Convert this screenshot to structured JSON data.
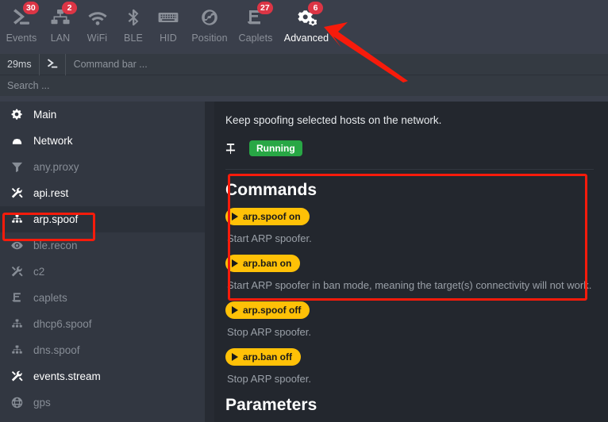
{
  "topnav": {
    "items": [
      {
        "label": "Events",
        "icon": "terminal-prompt-icon",
        "badge": "30",
        "active": false,
        "key": "events"
      },
      {
        "label": "LAN",
        "icon": "network-wired-icon",
        "badge": "2",
        "active": false,
        "key": "lan"
      },
      {
        "label": "WiFi",
        "icon": "wifi-icon",
        "badge": "",
        "active": false,
        "key": "wifi"
      },
      {
        "label": "BLE",
        "icon": "bluetooth-icon",
        "badge": "",
        "active": false,
        "key": "ble"
      },
      {
        "label": "HID",
        "icon": "keyboard-icon",
        "badge": "",
        "active": false,
        "key": "hid"
      },
      {
        "label": "Position",
        "icon": "globe-position-icon",
        "badge": "",
        "active": false,
        "key": "position"
      },
      {
        "label": "Caplets",
        "icon": "scroll-icon",
        "badge": "27",
        "active": false,
        "key": "caplets"
      },
      {
        "label": "Advanced",
        "icon": "gears-icon",
        "badge": "6",
        "active": true,
        "key": "advanced"
      }
    ]
  },
  "commandbar": {
    "latency": "29ms",
    "prompt_icon": "terminal-prompt-icon",
    "placeholder": "Command bar ...",
    "value": ""
  },
  "searchbar": {
    "placeholder": "Search ...",
    "value": ""
  },
  "sidebar": {
    "items": [
      {
        "label": "Main",
        "icon": "gear-icon",
        "active": true,
        "selected": false
      },
      {
        "label": "Network",
        "icon": "network-wired-icon",
        "active": true,
        "selected": false
      },
      {
        "label": "any.proxy",
        "icon": "filter-icon",
        "active": false,
        "selected": false
      },
      {
        "label": "api.rest",
        "icon": "tools-icon",
        "active": true,
        "selected": false
      },
      {
        "label": "arp.spoof",
        "icon": "sitemap-icon",
        "active": true,
        "selected": true
      },
      {
        "label": "ble.recon",
        "icon": "eye-icon",
        "active": false,
        "selected": false
      },
      {
        "label": "c2",
        "icon": "tools-icon",
        "active": false,
        "selected": false
      },
      {
        "label": "caplets",
        "icon": "scroll-icon",
        "active": false,
        "selected": false
      },
      {
        "label": "dhcp6.spoof",
        "icon": "sitemap-icon",
        "active": false,
        "selected": false
      },
      {
        "label": "dns.spoof",
        "icon": "sitemap-icon",
        "active": false,
        "selected": false
      },
      {
        "label": "events.stream",
        "icon": "tools-icon",
        "active": true,
        "selected": false
      },
      {
        "label": "gps",
        "icon": "globe-icon",
        "active": false,
        "selected": false
      }
    ]
  },
  "main": {
    "description": "Keep spoofing selected hosts on the network.",
    "pin_icon": "pin-icon",
    "status": "Running",
    "status_color": "#28a745",
    "commands_heading": "Commands",
    "commands": [
      {
        "label": "arp.spoof on",
        "desc": "Start ARP spoofer."
      },
      {
        "label": "arp.ban on",
        "desc": "Start ARP spoofer in ban mode, meaning the target(s) connectivity will not work."
      },
      {
        "label": "arp.spoof off",
        "desc": "Stop ARP spoofer."
      },
      {
        "label": "arp.ban off",
        "desc": "Stop ARP spoofer."
      }
    ],
    "parameters_heading": "Parameters"
  },
  "annotations": {
    "highlight_color": "#f71b0b",
    "arrow_target": "Advanced",
    "boxes": [
      "arp.spoof sidebar item",
      "Commands section"
    ]
  },
  "theme": {
    "accent_yellow": "#ffc107",
    "badge_red": "#dc3545",
    "running_green": "#28a745",
    "nav_bg": "#3a3f4b",
    "sidebar_bg": "#323741",
    "content_bg": "#23272e"
  }
}
